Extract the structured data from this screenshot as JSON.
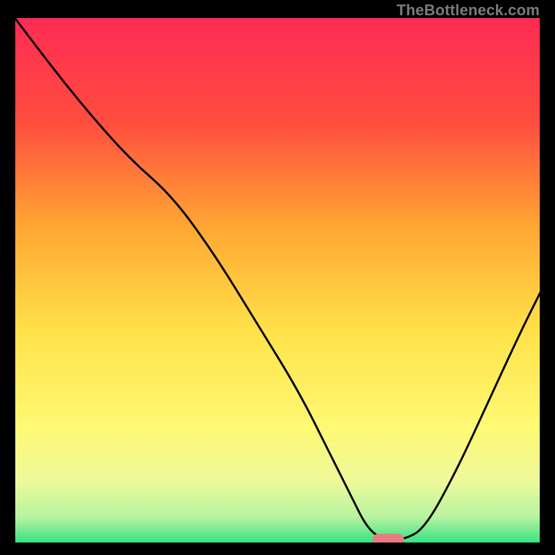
{
  "watermark": "TheBottleneck.com",
  "chart_data": {
    "type": "line",
    "title": "",
    "xlabel": "",
    "ylabel": "",
    "xlim": [
      0,
      100
    ],
    "ylim": [
      0,
      100
    ],
    "grid": false,
    "legend": false,
    "background_gradient_stops": [
      {
        "offset": 0.0,
        "color": "#ff2a55"
      },
      {
        "offset": 0.2,
        "color": "#ff4d3f"
      },
      {
        "offset": 0.4,
        "color": "#ffa733"
      },
      {
        "offset": 0.6,
        "color": "#ffe24a"
      },
      {
        "offset": 0.78,
        "color": "#fff974"
      },
      {
        "offset": 0.88,
        "color": "#eef99a"
      },
      {
        "offset": 0.95,
        "color": "#b6f3a0"
      },
      {
        "offset": 1.0,
        "color": "#2fe181"
      }
    ],
    "series": [
      {
        "name": "bottleneck-curve",
        "x": [
          0.0,
          6,
          14,
          22,
          30,
          38,
          46,
          54,
          60,
          64,
          67,
          70,
          74,
          78,
          84,
          90,
          96,
          100
        ],
        "y": [
          100,
          92,
          82,
          73,
          66,
          55,
          42,
          29,
          17,
          9,
          3,
          0.8,
          0.8,
          3,
          14,
          27,
          40,
          48
        ]
      }
    ],
    "marker": {
      "name": "optimal-marker",
      "x": 71,
      "y": 0.8,
      "width": 6,
      "height": 2.2,
      "color": "#e97b7d"
    }
  }
}
